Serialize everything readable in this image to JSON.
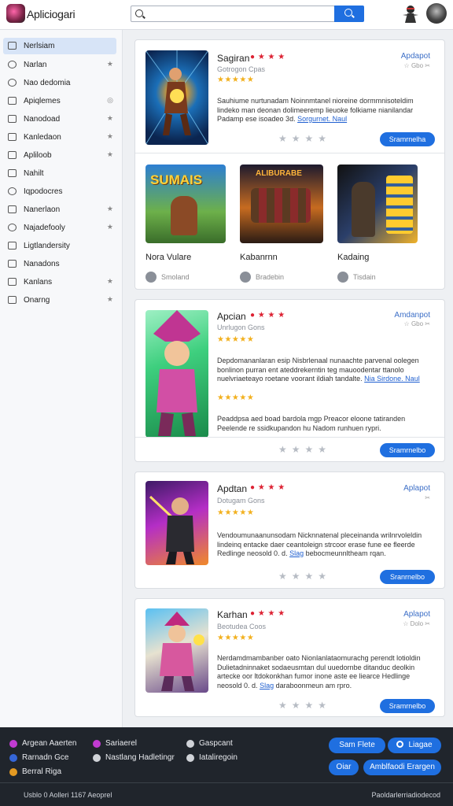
{
  "header": {
    "brand": "Apliciogari",
    "search_placeholder": ""
  },
  "sidebar": {
    "items": [
      {
        "label": "Nerlsiam",
        "icon": "menu-icon",
        "star": "",
        "active": true
      },
      {
        "label": "Narlan",
        "icon": "circle-icon",
        "star": "★"
      },
      {
        "label": "Nao dedomia",
        "icon": "circle-icon",
        "star": ""
      },
      {
        "label": "Apiqlemes",
        "icon": "calendar-icon",
        "star": "◎"
      },
      {
        "label": "Nanodoad",
        "icon": "box-icon",
        "star": "★"
      },
      {
        "label": "Kanledaon",
        "icon": "tools-icon",
        "star": "★"
      },
      {
        "label": "Apliloob",
        "icon": "box-icon",
        "star": "★"
      },
      {
        "label": "Nahilt",
        "icon": "document-icon",
        "star": ""
      },
      {
        "label": "Iqpodocres",
        "icon": "circle-icon",
        "star": ""
      },
      {
        "label": "Nanerlaon",
        "icon": "document-icon",
        "star": "★"
      },
      {
        "label": "Najadefooly",
        "icon": "clock-icon",
        "star": "★"
      },
      {
        "label": "Ligtlandersity",
        "icon": "tag-icon",
        "star": ""
      },
      {
        "label": "Nanadons",
        "icon": "tools-icon",
        "star": ""
      },
      {
        "label": "Kanlans",
        "icon": "document-icon",
        "star": "★"
      },
      {
        "label": "Onarng",
        "icon": "gift-icon",
        "star": "★"
      }
    ]
  },
  "cards": [
    {
      "title": "Sagiran",
      "rating_icons": "● ★ ★ ★",
      "sub": "Gotrogon Cpas",
      "stars": "★★★★★",
      "tag": "Apdapot",
      "tag2": "☆ Gbo ✂",
      "desc": "Sauhiume nurtunadam Noinnmtanel nioreine dormmnisoteldim lindeko man deonan dolimeeremp lieuoke folkiame nianilandar Padamp ese isoadeo 3d.",
      "desc_link": "Sorgurnet. Naul",
      "button": "Sramrnelha"
    },
    {
      "title": "Apcian",
      "rating_icons": "● ★ ★ ★",
      "sub": "Unrlugon Gons",
      "stars": "★★★★★",
      "tag": "Amdanpot",
      "tag2": "☆ Gbo ✂",
      "desc": "Depdomananlaran esip Nisbrlenaal nunaachte parvenal oolegen bonlinon purran ent ateddrekerntin teg mauoodentar ttanolo nuelvriaeteayo roetane voorant ildiah tandalte.",
      "desc_link": "Nia Sirdone. Naul",
      "stars2": "★★★★★",
      "desc2": "Peaddpsa aed boad bardola mgp Preacor eloone tatiranden Peelende re ssidkupandon hu Nadom runhuen rypri.",
      "button": "Sramrnelbo"
    },
    {
      "title": "Apdtan",
      "rating_icons": "● ★ ★ ★",
      "sub": "Dotugam Gons",
      "stars": "★★★★★",
      "tag": "Aplapot",
      "tag2": "✂",
      "desc": "Vendoumunaanunsodam Nicknnatenal pleceinanda wrilnrvoleldin lindeinq entacke daer ceantoleign strcoor erase fune ee fleerde Redlinge neosold 0. d.",
      "desc_link": "Slag",
      "desc_after": "bebocmeunnltheam rqan.",
      "button": "Sranrnelbo"
    },
    {
      "title": "Karhan",
      "rating_icons": "● ★ ★ ★",
      "sub": "Beotudea Coos",
      "stars": "★★★★★",
      "tag": "Aplapot",
      "tag2": "☆ Dolo ✂",
      "desc": "Nerdamdmambanber oato Nionlanlataomurachg perendt lotioldin Dulietadninnaket sodaeusmtan dul uuedornbe ditanduc deolkin artecke oor ltdokonkhan fumor inone aste ee liearce Hedlinge neosold 0. d.",
      "desc_link": "Slag",
      "desc_after": "daraboonmeun am rpro.",
      "button": "Sramrnelbo"
    }
  ],
  "featured": [
    {
      "title": "Nora Vulare",
      "author": "Smoland",
      "art_text": "SUMAIS"
    },
    {
      "title": "Kabanrnn",
      "author": "Bradebin",
      "art_text": "ALIBURABE"
    },
    {
      "title": "Kadaing",
      "author": "Tisdain",
      "art_text": ""
    }
  ],
  "footer": {
    "links": [
      {
        "label": "Argean Aaerten",
        "color": "#c13bd2"
      },
      {
        "label": "Sariaerel",
        "color": "#c13bd2"
      },
      {
        "label": "Gaspcant",
        "color": "#d0d3d8"
      },
      {
        "label": "Rarnadn Gce",
        "color": "#3566d8"
      },
      {
        "label": "Nastlang Hadletingr",
        "color": "#d0d3d8"
      },
      {
        "label": "Iataliregoin",
        "color": "#d0d3d8"
      },
      {
        "label": "Berral Riga",
        "color": "#e39a22"
      }
    ],
    "buttons": [
      "Sam Flete",
      "Liagae",
      "Oiar",
      "Amblfaodi Erargen"
    ],
    "copyright": "Usblo 0 Aolleri 1167 Aeoprel",
    "legal": "Paoldarlerriadiodecod"
  }
}
